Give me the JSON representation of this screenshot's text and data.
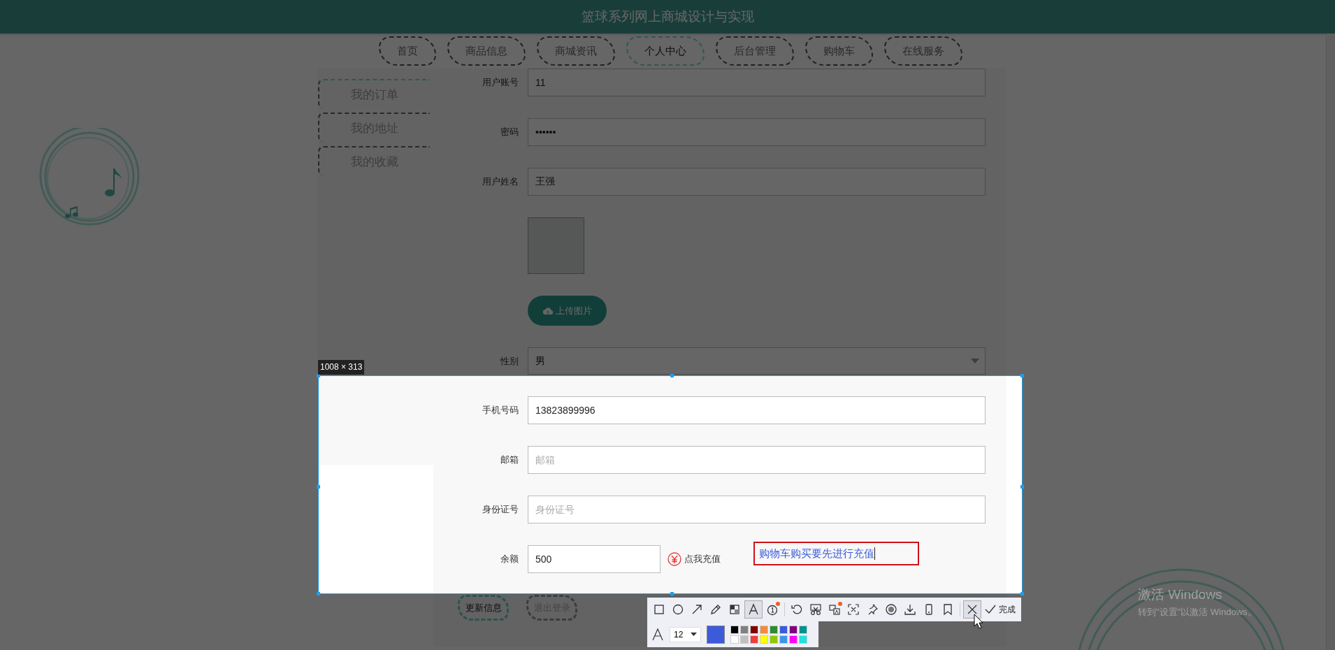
{
  "header": {
    "title": "篮球系列网上商城设计与实现"
  },
  "nav": [
    {
      "label": "首页",
      "selected": false
    },
    {
      "label": "商品信息",
      "selected": false
    },
    {
      "label": "商城资讯",
      "selected": false
    },
    {
      "label": "个人中心",
      "selected": true
    },
    {
      "label": "后台管理",
      "selected": false
    },
    {
      "label": "购物车",
      "selected": false
    },
    {
      "label": "在线服务",
      "selected": false
    }
  ],
  "sidebar": {
    "items": [
      {
        "label": "我的订单",
        "selected": true
      },
      {
        "label": "我的地址",
        "selected": false
      },
      {
        "label": "我的收藏",
        "selected": false
      }
    ]
  },
  "form": {
    "fields": [
      {
        "kind": "input",
        "label": "用户账号",
        "value": "11"
      },
      {
        "kind": "input",
        "label": "密码",
        "value": "••••••"
      },
      {
        "kind": "input",
        "label": "用户姓名",
        "value": "王强"
      },
      {
        "kind": "avatar"
      },
      {
        "kind": "upload",
        "button": "上传图片"
      },
      {
        "kind": "select",
        "label": "性别",
        "value": "男"
      },
      {
        "kind": "input",
        "label": "手机号码",
        "value": "13823899996"
      },
      {
        "kind": "input",
        "label": "邮箱",
        "placeholder": "邮箱"
      },
      {
        "kind": "input",
        "label": "身份证号",
        "placeholder": "身份证号"
      },
      {
        "kind": "balance",
        "label": "余额",
        "value": "500",
        "link": "点我充值"
      }
    ],
    "buttons": [
      {
        "kind": "primary",
        "label": "更新信息"
      },
      {
        "kind": "secondary",
        "label": "退出登录"
      }
    ]
  },
  "capture": {
    "size": "1008 × 313",
    "annotation": "购物车购买要先进行充值",
    "tool_groups": [
      [
        {
          "kind": "rectangle",
          "selected": false,
          "badge": false
        },
        {
          "kind": "ellipse",
          "selected": false,
          "badge": false
        },
        {
          "kind": "arrow",
          "selected": false,
          "badge": false
        },
        {
          "kind": "pencil",
          "selected": false,
          "badge": false
        },
        {
          "kind": "mosaic",
          "selected": false,
          "badge": false
        },
        {
          "kind": "text",
          "selected": true,
          "badge": false
        },
        {
          "kind": "number",
          "selected": false,
          "badge": true
        }
      ],
      [
        {
          "kind": "undo",
          "selected": false,
          "badge": false
        },
        {
          "kind": "scissors",
          "selected": false,
          "badge": false
        },
        {
          "kind": "translate",
          "selected": false,
          "badge": true
        },
        {
          "kind": "scan",
          "selected": false,
          "badge": false
        },
        {
          "kind": "pin",
          "selected": false,
          "badge": false
        },
        {
          "kind": "record",
          "selected": false,
          "badge": false
        },
        {
          "kind": "download",
          "selected": false,
          "badge": false
        },
        {
          "kind": "phone",
          "selected": false,
          "badge": false
        },
        {
          "kind": "bookmark",
          "selected": false,
          "badge": false
        }
      ],
      [
        {
          "kind": "close",
          "selected": true,
          "badge": false
        }
      ]
    ],
    "done": "完成",
    "font_size": "12",
    "pen": {
      "color": "#3b5bdb"
    },
    "palette": [
      {
        "color": "#000000"
      },
      {
        "color": "#808080"
      },
      {
        "color": "#800000"
      },
      {
        "color": "#f08c3c"
      },
      {
        "color": "#2e8b2e"
      },
      {
        "color": "#3b5bdb"
      },
      {
        "color": "#800080"
      },
      {
        "color": "#009090"
      },
      {
        "color": "#ffffff"
      },
      {
        "color": "#c0c0c0"
      },
      {
        "color": "#f03c3c"
      },
      {
        "color": "#ffff00"
      },
      {
        "color": "#90c800"
      },
      {
        "color": "#3c96e6"
      },
      {
        "color": "#ff00ff"
      },
      {
        "color": "#20e0e0"
      }
    ]
  },
  "os_notice": {
    "title": "激活 Windows",
    "text": "转到\"设置\"以激活 Windows。"
  }
}
